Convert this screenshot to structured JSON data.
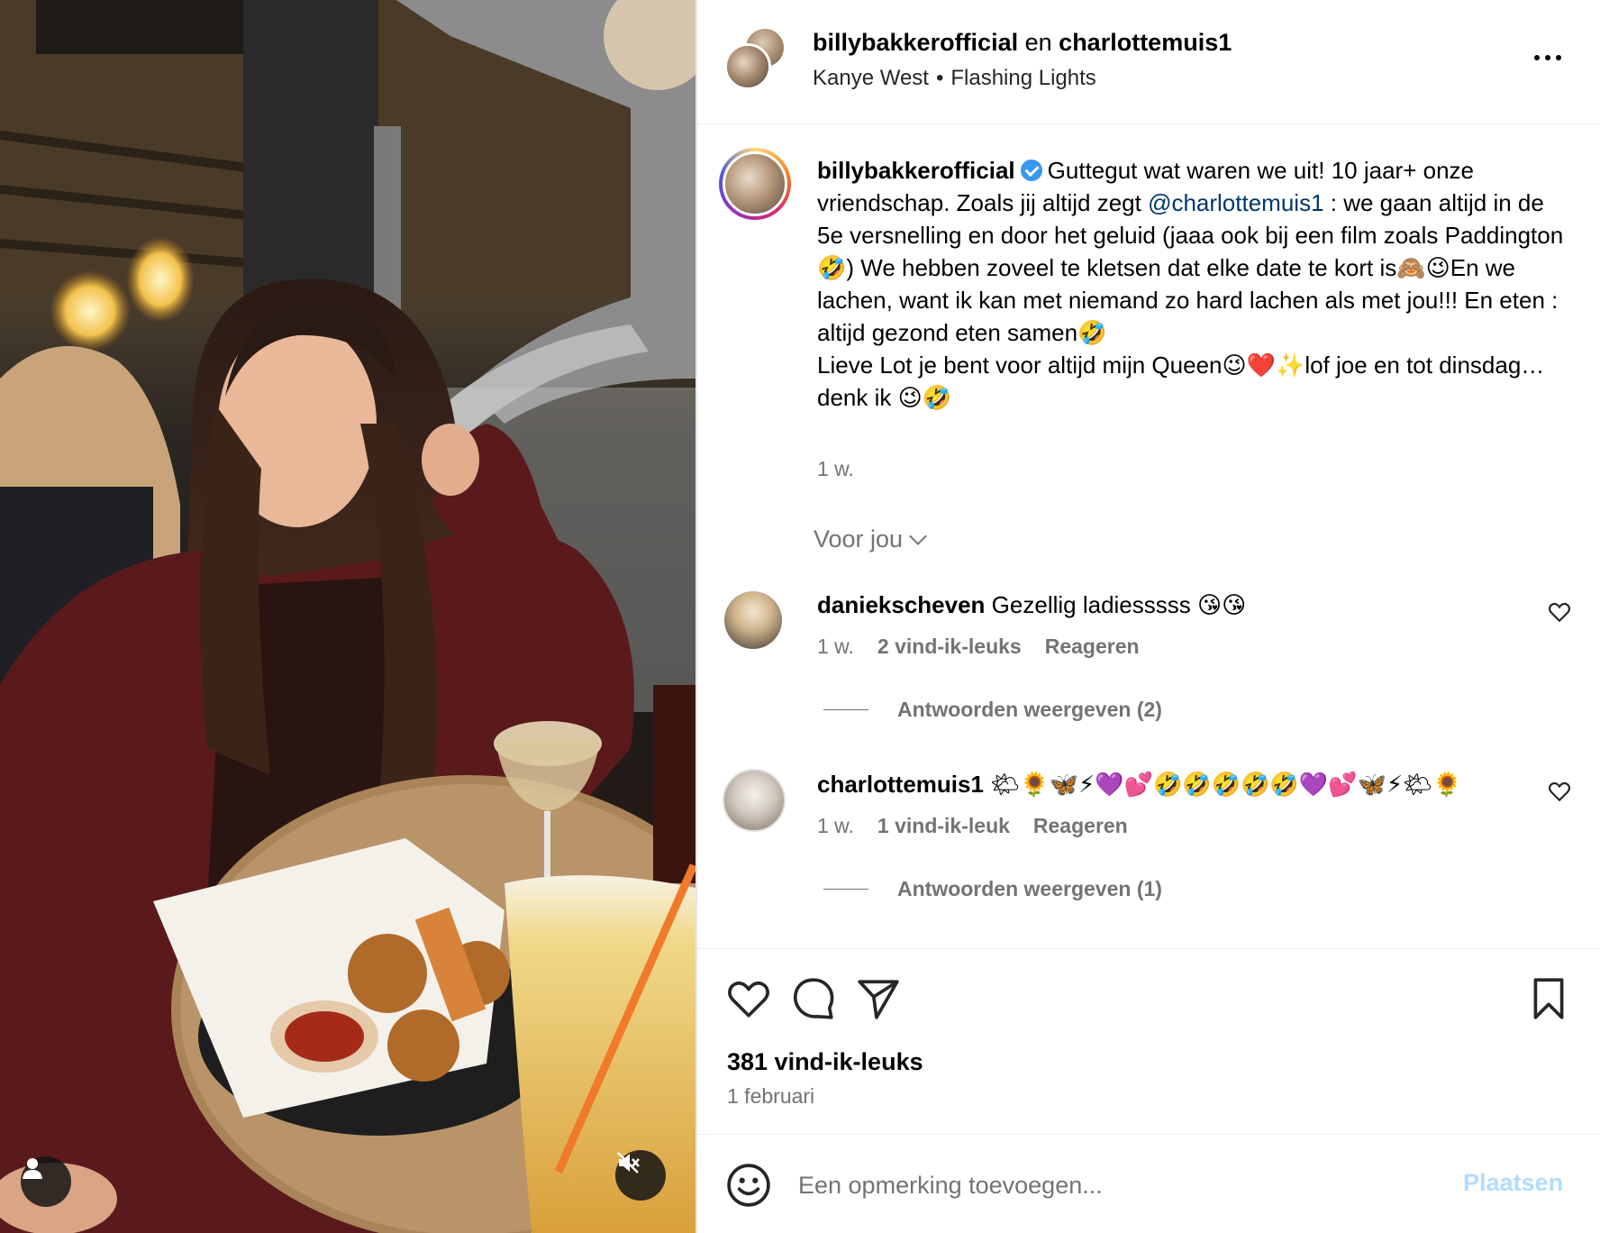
{
  "header": {
    "user1": "billybakkerofficial",
    "joiner": "en",
    "user2": "charlottemuis1",
    "music_artist": "Kanye West",
    "music_separator": "•",
    "music_track": "Flashing Lights"
  },
  "caption": {
    "username": "billybakkerofficial",
    "text_part1": "Guttegut wat waren we uit! 10 jaar+ onze vriendschap. Zoals jij altijd zegt ",
    "mention": "@charlottemuis1",
    "text_part2": " : we gaan altijd in de 5e versnelling en door het geluid (jaaa ook bij een film zoals Paddington🤣) We hebben zoveel te kletsen dat elke date te kort is🙈😉En we lachen, want ik kan met niemand zo hard lachen als met jou!!! En eten : altijd gezond eten samen🤣\nLieve Lot je bent voor altijd mijn Queen😉❤️✨lof joe en tot dinsdag…denk ik 😉🤣",
    "time": "1 w."
  },
  "section": {
    "for_you_label": "Voor jou"
  },
  "comments": [
    {
      "username": "daniekscheven",
      "text": "Gezellig ladiesssss 😘😘",
      "time": "1 w.",
      "likes": "2 vind-ik-leuks",
      "reply_label": "Reageren",
      "view_replies": "Antwoorden weergeven (2)"
    },
    {
      "username": "charlottemuis1",
      "text": "🌤🌻🦋⚡💜💕🤣🤣🤣🤣🤣💜💕🦋⚡🌤🌻",
      "time": "1 w.",
      "likes": "1 vind-ik-leuk",
      "reply_label": "Reageren",
      "view_replies": "Antwoorden weergeven (1)"
    }
  ],
  "footer": {
    "likes": "381 vind-ik-leuks",
    "date": "1 februari",
    "comment_placeholder": "Een opmerking toevoegen...",
    "post_label": "Plaatsen"
  },
  "colors": {
    "link": "#00376b",
    "secondary_text": "#737373",
    "verified": "#3897f0",
    "post_disabled": "#b3dbff"
  },
  "icons": [
    "like-icon",
    "comment-icon",
    "share-icon",
    "save-icon",
    "emoji-icon",
    "more-icon",
    "verified-icon",
    "user-tag-icon",
    "mute-icon",
    "chevron-down-icon"
  ]
}
